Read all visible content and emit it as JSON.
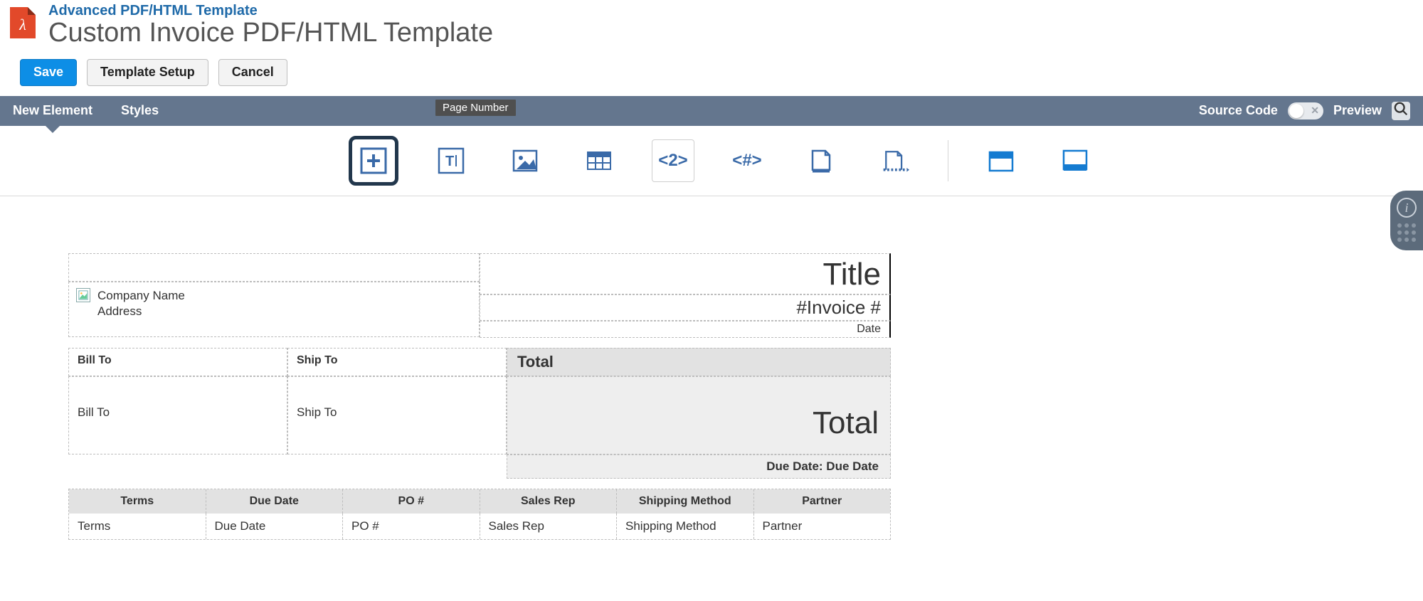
{
  "header": {
    "breadcrumb": "Advanced PDF/HTML Template",
    "title": "Custom Invoice PDF/HTML Template",
    "pdf_glyph": "λ"
  },
  "actions": {
    "save": "Save",
    "template_setup": "Template Setup",
    "cancel": "Cancel"
  },
  "tooltip": "Page Number",
  "navbar": {
    "new_element": "New Element",
    "styles": "Styles",
    "source_code": "Source Code",
    "preview": "Preview"
  },
  "toolbar_icons": [
    "add-element",
    "text",
    "image",
    "table",
    "page-number",
    "page-count",
    "page-break",
    "page-break-after",
    "header",
    "footer"
  ],
  "template": {
    "company_name": "Company Name",
    "address": "Address",
    "title_ph": "Title",
    "invoice_no_ph": "#Invoice #",
    "date_ph": "Date",
    "bill_to_label": "Bill To",
    "ship_to_label": "Ship To",
    "bill_to_value": "Bill To",
    "ship_to_value": "Ship To",
    "total_label": "Total",
    "total_value": "Total",
    "due_date_row": "Due Date: Due Date",
    "columns": [
      "Terms",
      "Due Date",
      "PO #",
      "Sales Rep",
      "Shipping Method",
      "Partner"
    ],
    "row_values": [
      "Terms",
      "Due Date",
      "PO #",
      "Sales Rep",
      "Shipping Method",
      "Partner"
    ]
  }
}
